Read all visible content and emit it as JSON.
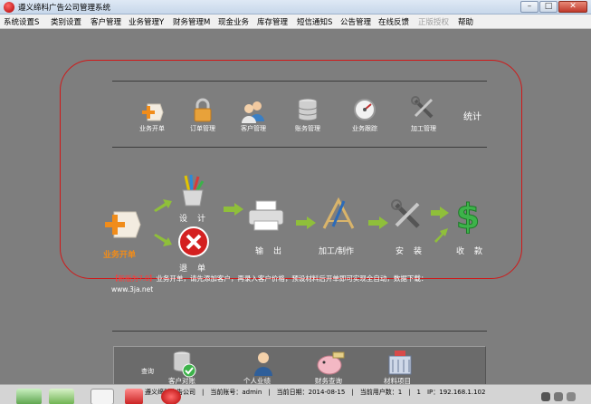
{
  "window": {
    "title": "遵义缔科广告公司管理系统",
    "controls": [
      "–",
      "□",
      "✕"
    ]
  },
  "menu": [
    {
      "label": "系统设置S"
    },
    {
      "label": "类别设置"
    },
    {
      "label": "客户管理"
    },
    {
      "label": "业务管理Y"
    },
    {
      "label": "财务管理M"
    },
    {
      "label": "现金业务"
    },
    {
      "label": "库存管理"
    },
    {
      "label": "短信通知S"
    },
    {
      "label": "公告管理"
    },
    {
      "label": "在线反馈"
    },
    {
      "label": "正版授权",
      "disabled": true
    },
    {
      "label": "帮助"
    }
  ],
  "toolbar": {
    "items": [
      {
        "label": "业务开单",
        "icon": "plus-tag-icon"
      },
      {
        "label": "订单管理",
        "icon": "lock-icon"
      },
      {
        "label": "客户管理",
        "icon": "users-icon"
      },
      {
        "label": "账务管理",
        "icon": "database-icon"
      },
      {
        "label": "业务跟踪",
        "icon": "gauge-icon"
      },
      {
        "label": "加工管理",
        "icon": "wrench-screwdriver-icon"
      }
    ],
    "stats_label": "统计"
  },
  "flow": {
    "start": "业务开单",
    "design": "设　计",
    "return": "退　单",
    "output": "输　出",
    "process": "加工/制作",
    "install": "安　装",
    "collect": "收　款"
  },
  "notice": {
    "bracket": "【新版为7.0】",
    "text": "业务开单，请先添加客户，再录入客户价格，预设材料后开单即可实现全自动，数据下载：",
    "url": "www.3ja.net"
  },
  "query_panel": {
    "label": "查询",
    "items": [
      {
        "label": "客户对账",
        "icon": "database-check-icon"
      },
      {
        "label": "个人业绩",
        "icon": "person-icon"
      },
      {
        "label": "财务查询",
        "icon": "piggy-bank-icon"
      },
      {
        "label": "材料项目",
        "icon": "building-icon"
      }
    ]
  },
  "status": {
    "text": "遵义缔科广告公司　|　当前账号：admin　|　当前日期：2014-08-15　|　当前用户数：1　|　1　IP：192.168.1.102"
  },
  "colors": {
    "background": "#7e7e7e",
    "outline": "#d01818",
    "arrow": "#8fbf3a",
    "highlight": "#f08c1a"
  }
}
